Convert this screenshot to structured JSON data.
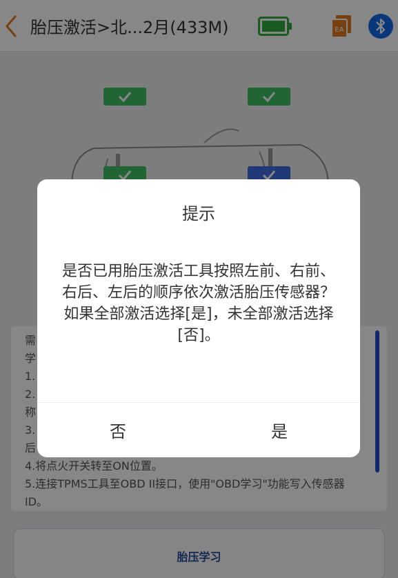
{
  "header": {
    "title": "胎压激活>北...2月(433M)",
    "back_icon": "chevron-left-icon",
    "battery_icon": "battery-full-icon",
    "report_icon": "report-document-icon",
    "bluetooth_icon": "bluetooth-icon"
  },
  "colors": {
    "accent_orange": "#e07a1f",
    "battery_green": "#2faa3c",
    "bluetooth_blue": "#1468e6",
    "sensor_green": "#3fbf63",
    "sensor_blue": "#3f6fe0",
    "primary_blue": "#264c9a"
  },
  "car_diagram": {
    "sensors": [
      {
        "position": "front-left",
        "status": "activated",
        "color": "green"
      },
      {
        "position": "front-right",
        "status": "activated",
        "color": "green"
      },
      {
        "position": "rear-left",
        "status": "activated",
        "color": "green"
      },
      {
        "position": "rear-right",
        "status": "activated",
        "color": "blue"
      }
    ]
  },
  "info": {
    "lines": [
      "需",
      "学",
      "1.",
      "2.",
      "称",
      "3.",
      "后",
      "4.将点火开关转至ON位置。",
      "5.连接TPMS工具至OBD II接口，使用\"OBD学习\"功能写入传感器",
      "ID。"
    ]
  },
  "learn_button": {
    "label": "胎压学习"
  },
  "dialog": {
    "title": "提示",
    "message": "是否已用胎压激活工具按照左前、右前、右后、左后的顺序依次激活胎压传感器？如果全部激活选择[是]，未全部激活选择[否]。",
    "no_label": "否",
    "yes_label": "是"
  }
}
